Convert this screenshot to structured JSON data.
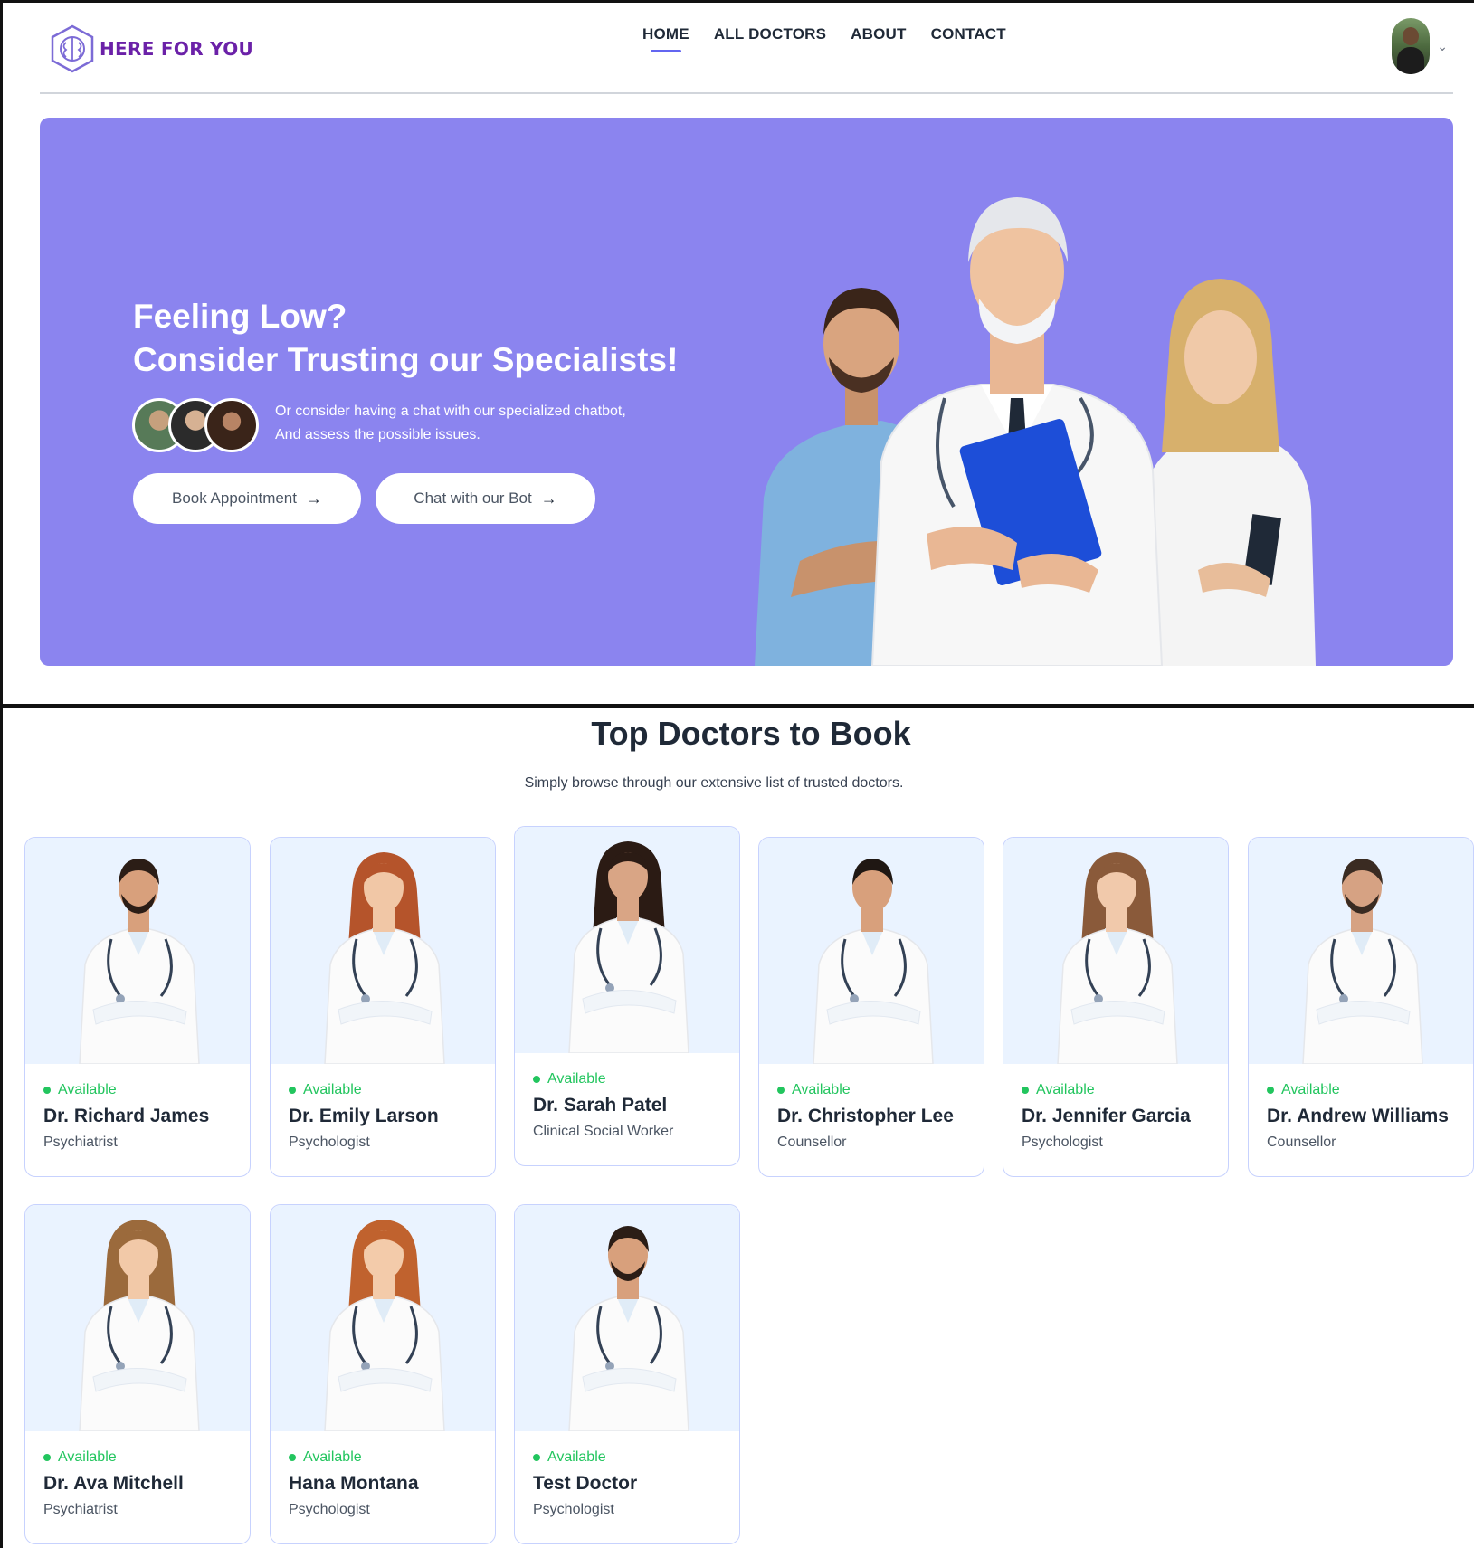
{
  "brand": {
    "name": "HERE FOR YOU"
  },
  "nav": {
    "links": [
      {
        "label": "HOME",
        "active": true
      },
      {
        "label": "ALL DOCTORS",
        "active": false
      },
      {
        "label": "ABOUT",
        "active": false
      },
      {
        "label": "CONTACT",
        "active": false
      }
    ]
  },
  "hero": {
    "title_line1": "Feeling Low?",
    "title_line2": "Consider Trusting our Specialists!",
    "subtitle_line1": "Or consider having a chat with our specialized chatbot,",
    "subtitle_line2": "And assess the possible issues.",
    "book_label": "Book Appointment",
    "chat_label": "Chat with our Bot",
    "background_color": "#8b84ef"
  },
  "section": {
    "title": "Top Doctors to Book",
    "subtitle": "Simply browse through our extensive list of trusted doctors."
  },
  "doctors": [
    {
      "status": "Available",
      "name": "Dr. Richard James",
      "specialty": "Psychiatrist"
    },
    {
      "status": "Available",
      "name": "Dr. Emily Larson",
      "specialty": "Psychologist"
    },
    {
      "status": "Available",
      "name": "Dr. Sarah Patel",
      "specialty": "Clinical Social Worker"
    },
    {
      "status": "Available",
      "name": "Dr. Christopher Lee",
      "specialty": "Counsellor"
    },
    {
      "status": "Available",
      "name": "Dr. Jennifer Garcia",
      "specialty": "Psychologist"
    },
    {
      "status": "Available",
      "name": "Dr. Andrew Williams",
      "specialty": "Counsellor"
    },
    {
      "status": "Available",
      "name": "Dr. Ava Mitchell",
      "specialty": "Psychiatrist"
    },
    {
      "status": "Available",
      "name": "Hana Montana",
      "specialty": "Psychologist"
    },
    {
      "status": "Available",
      "name": "Test Doctor",
      "specialty": "Psychologist"
    }
  ],
  "colors": {
    "accent": "#6366f1",
    "brand": "#6b21a8",
    "available": "#22c55e",
    "card_image_bg": "#eaf3ff"
  },
  "icons": {
    "logo": "brain-hexagon-icon",
    "profile_dropdown": "chevron-down-icon",
    "button_arrow": "arrow-right-icon",
    "status_dot": "status-dot-icon"
  }
}
